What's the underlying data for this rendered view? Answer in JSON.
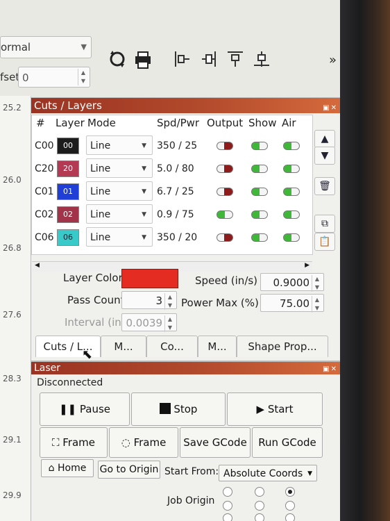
{
  "toolbar": {
    "combo_value": "ormal",
    "offset_label": "fset",
    "offset_value": "0",
    "icons": [
      "rotate-icon",
      "printer-icon",
      "align-left-icon",
      "align-center-icon",
      "align-top-icon",
      "align-middle-icon"
    ],
    "more_label": "»"
  },
  "ruler": {
    "ticks": [
      "25.2",
      "26.0",
      "26.8",
      "27.6",
      "28.3",
      "29.1",
      "29.9"
    ]
  },
  "cuts": {
    "title": "Cuts / Layers",
    "headers": [
      "#",
      "Layer",
      "Mode",
      "Spd/Pwr",
      "Output",
      "Show",
      "Air"
    ],
    "rows": [
      {
        "name": "C00",
        "layer": "00",
        "color": "#1c1c1c",
        "mode": "Line",
        "spd": "350 / 25",
        "output": false,
        "show": true,
        "air": true
      },
      {
        "name": "C20",
        "layer": "20",
        "color": "#b33a52",
        "mode": "Line",
        "spd": "5.0 / 80",
        "output": false,
        "show": true,
        "air": true
      },
      {
        "name": "C01",
        "layer": "01",
        "color": "#1f3fd6",
        "mode": "Line",
        "spd": "6.7 / 25",
        "output": false,
        "show": true,
        "air": true
      },
      {
        "name": "C02",
        "layer": "02",
        "color": "#a2344a",
        "mode": "Line",
        "spd": "0.9 / 75",
        "output": true,
        "show": true,
        "air": true
      },
      {
        "name": "C06",
        "layer": "06",
        "color": "#38c9c9",
        "mode": "Line",
        "spd": "350 / 20",
        "output": false,
        "show": true,
        "air": true
      }
    ],
    "props": {
      "layer_color_label": "Layer Color",
      "layer_color": "#e52c22",
      "speed_label": "Speed (in/s)",
      "speed_value": "0.9000",
      "pass_count_label": "Pass Count",
      "pass_count_value": "3",
      "power_max_label": "Power Max (%)",
      "power_max_value": "75.00",
      "interval_label": "Interval (in)",
      "interval_value": "0.0039"
    },
    "tabs": [
      "Cuts / L...",
      "M...",
      "Co...",
      "M...",
      "Shape Prop..."
    ]
  },
  "laser": {
    "title": "Laser",
    "status": "Disconnected",
    "pause": "Pause",
    "stop": "Stop",
    "start": "Start",
    "frame1": "Frame",
    "frame2": "Frame",
    "save_gcode": "Save GCode",
    "run_gcode": "Run GCode",
    "home": "Home",
    "go_to_origin": "Go to Origin",
    "start_from_label": "Start From:",
    "start_from_value": "Absolute Coords",
    "job_origin_label": "Job Origin"
  }
}
